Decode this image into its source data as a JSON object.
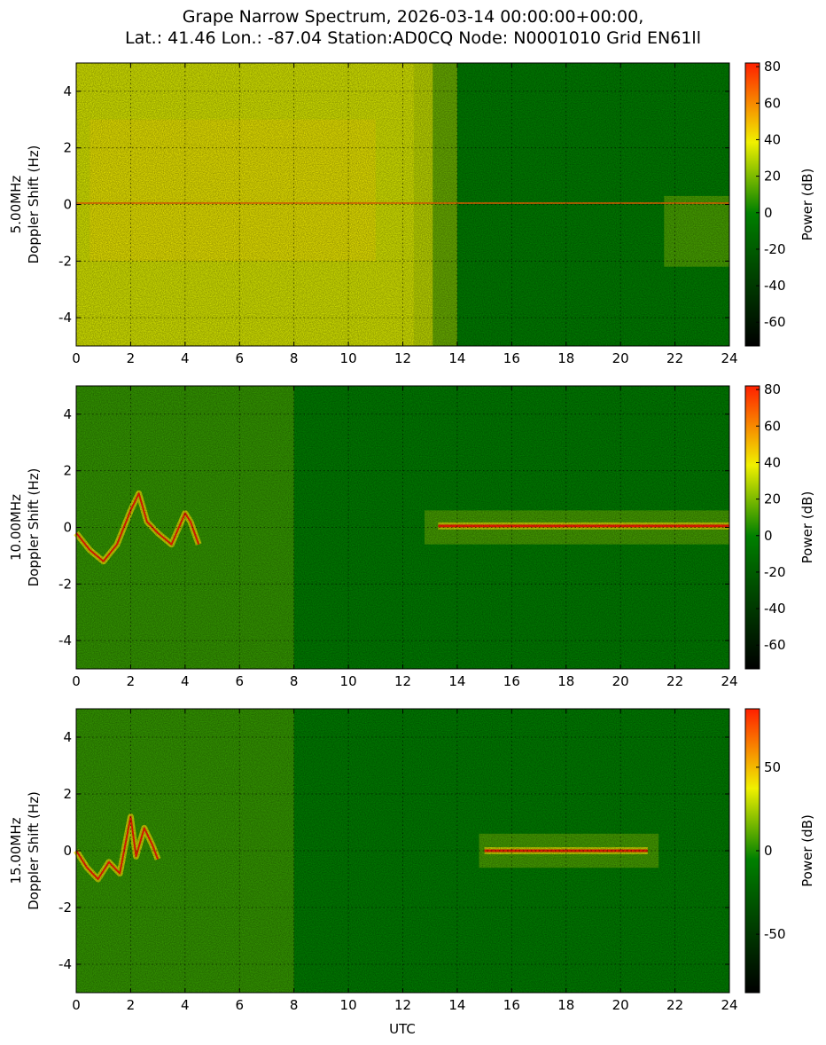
{
  "title_line1": "Grape Narrow Spectrum, 2026-03-14 00:00:00+00:00,",
  "title_line2": "Lat.: 41.46 Lon.: -87.04 Station:AD0CQ Node: N0001010 Grid EN61ll",
  "xlabel": "UTC",
  "colorbar_label": "Power (dB)",
  "colors": {
    "background_green": "#008000",
    "mid_yellow": "#f0f000",
    "peak_red": "#ff2000",
    "low_black": "#000000"
  },
  "chart_data": [
    {
      "type": "heatmap",
      "panel": "5.00MHz",
      "ylabel_line1": "5.00MHz",
      "ylabel_line2": "Doppler Shift (Hz)",
      "xlim": [
        0,
        24
      ],
      "ylim": [
        -5,
        5
      ],
      "xticks": [
        0,
        2,
        4,
        6,
        8,
        10,
        12,
        14,
        16,
        18,
        20,
        22,
        24
      ],
      "yticks": [
        -4,
        -2,
        0,
        2,
        4
      ],
      "grid": true,
      "colorbar_range": [
        -73,
        82
      ],
      "colorbar_ticks": [
        -60,
        -40,
        -20,
        0,
        20,
        40,
        60,
        80
      ],
      "description": "Strong yellow broadband noise 0-13 UTC, transition to green after 13 UTC, carrier near 0 Hz",
      "regions": [
        {
          "x": [
            0,
            13.1
          ],
          "y": [
            -5,
            5
          ],
          "level": 35
        },
        {
          "x": [
            13.1,
            24
          ],
          "y": [
            -5,
            5
          ],
          "level": 0
        },
        {
          "x": [
            13.1,
            24
          ],
          "y": [
            -0.05,
            0.05
          ],
          "level": 45
        },
        {
          "x": [
            21.5,
            24
          ],
          "y": [
            -2.2,
            0.3
          ],
          "level": 15
        }
      ]
    },
    {
      "type": "heatmap",
      "panel": "10.00MHz",
      "ylabel_line1": "10.00MHz",
      "ylabel_line2": "Doppler Shift (Hz)",
      "xlim": [
        0,
        24
      ],
      "ylim": [
        -5,
        5
      ],
      "xticks": [
        0,
        2,
        4,
        6,
        8,
        10,
        12,
        14,
        16,
        18,
        20,
        22,
        24
      ],
      "yticks": [
        -4,
        -2,
        0,
        2,
        4
      ],
      "grid": true,
      "colorbar_range": [
        -73,
        82
      ],
      "colorbar_ticks": [
        -60,
        -40,
        -20,
        0,
        20,
        40,
        60,
        80
      ],
      "description": "Red doppler trace 0-4.5 UTC, green with yellow streaks, strong red carrier ~0.1 Hz from 13.3 UTC",
      "trace": {
        "x": [
          0,
          0.5,
          1,
          1.5,
          2,
          2.3,
          2.6,
          3,
          3.5,
          4,
          4.2,
          4.5
        ],
        "y": [
          -0.2,
          -0.8,
          -1.2,
          -0.6,
          0.6,
          1.2,
          0.2,
          -0.2,
          -0.6,
          0.5,
          0.2,
          -0.6
        ]
      },
      "carrier": {
        "x": [
          13.3,
          24
        ],
        "y": 0.05
      }
    },
    {
      "type": "heatmap",
      "panel": "15.00MHz",
      "ylabel_line1": "15.00MHz",
      "ylabel_line2": "Doppler Shift (Hz)",
      "xlim": [
        0,
        24
      ],
      "ylim": [
        -5,
        5
      ],
      "xticks": [
        0,
        2,
        4,
        6,
        8,
        10,
        12,
        14,
        16,
        18,
        20,
        22,
        24
      ],
      "yticks": [
        -4,
        -2,
        0,
        2,
        4
      ],
      "grid": true,
      "colorbar_range": [
        -85,
        85
      ],
      "colorbar_ticks": [
        -50,
        0,
        50
      ],
      "description": "Red doppler trace 0-3 UTC, mostly green, yellow-red carrier near 0 Hz from 15 to 21 UTC",
      "trace": {
        "x": [
          0,
          0.4,
          0.8,
          1.2,
          1.6,
          2,
          2.2,
          2.5,
          2.8,
          3
        ],
        "y": [
          0,
          -0.6,
          -1.0,
          -0.4,
          -0.8,
          1.2,
          -0.2,
          0.8,
          0.2,
          -0.3
        ]
      },
      "carrier": {
        "x": [
          15,
          21
        ],
        "y": 0.0
      }
    }
  ]
}
